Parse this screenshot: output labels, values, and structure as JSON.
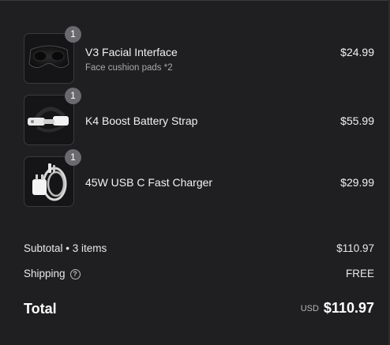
{
  "items": [
    {
      "name": "V3 Facial Interface",
      "variant": "Face cushion pads *2",
      "price": "$24.99",
      "quantity": "1",
      "image_icon": "facial-interface-image"
    },
    {
      "name": "K4 Boost Battery Strap",
      "variant": "",
      "price": "$55.99",
      "quantity": "1",
      "image_icon": "battery-strap-image"
    },
    {
      "name": "45W USB C Fast Charger",
      "variant": "",
      "price": "$29.99",
      "quantity": "1",
      "image_icon": "usb-charger-image"
    }
  ],
  "summary": {
    "subtotal_label": "Subtotal • 3 items",
    "subtotal_value": "$110.97",
    "shipping_label": "Shipping",
    "shipping_value": "FREE",
    "help_icon": "question-circle-icon",
    "total_label": "Total",
    "currency": "USD",
    "total_value": "$110.97"
  },
  "colors": {
    "background": "#1f1f21",
    "text": "#ffffff",
    "muted": "#a8a8ab",
    "badge": "#6a6a6e"
  }
}
